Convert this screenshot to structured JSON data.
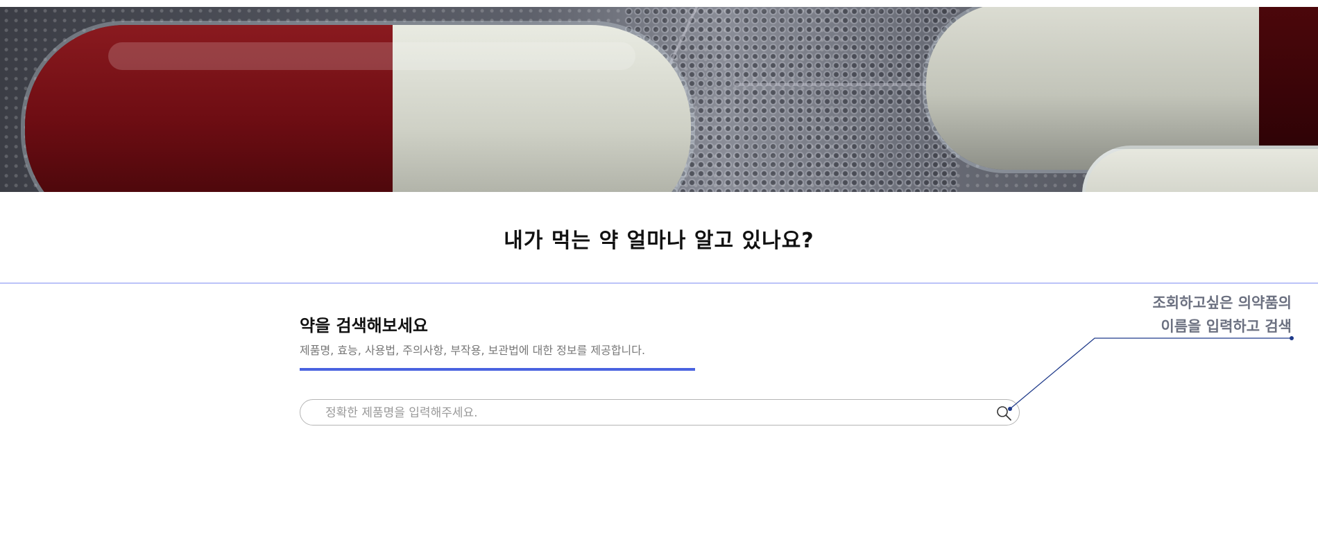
{
  "hero": {
    "image": "capsule-pills-banner"
  },
  "headline": "내가 먹는 약 얼마나 알고 있나요?",
  "search_section": {
    "title": "약을 검색해보세요",
    "description": "제품명, 효능, 사용법, 주의사항, 부작용, 보관법에 대한 정보를 제공합니다.",
    "input_placeholder": "정확한 제품명을 입력해주세요.",
    "input_value": "",
    "search_icon": "search-icon"
  },
  "callout": {
    "line1": "조회하고싶은 의약품의",
    "line2": "이름을 입력하고 검색"
  },
  "colors": {
    "accent": "#4a63e0",
    "divider": "#7f8ff2",
    "callout_line": "#1f3a8a"
  }
}
